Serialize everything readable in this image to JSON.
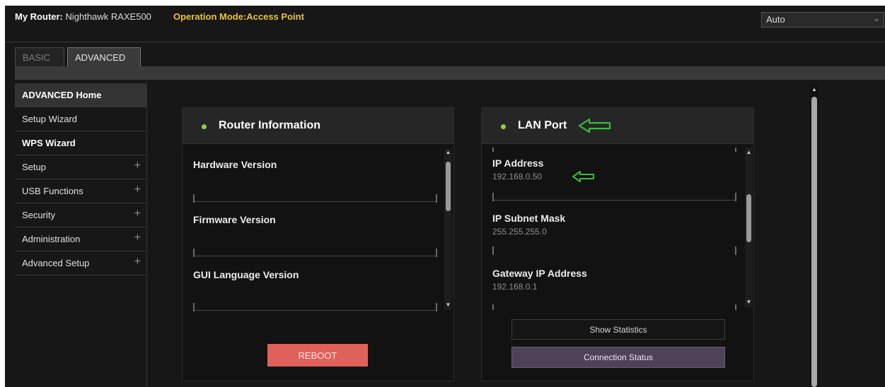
{
  "header": {
    "router_label": "My Router:",
    "router_name": "Nighthawk RAXE500",
    "operation_mode": "Operation Mode:Access Point",
    "language_select": "Auto"
  },
  "tabs": [
    {
      "label": "BASIC",
      "active": false
    },
    {
      "label": "ADVANCED",
      "active": true
    }
  ],
  "sidebar": {
    "items": [
      {
        "label": "ADVANCED Home",
        "expandable": false,
        "active": true
      },
      {
        "label": "Setup Wizard",
        "expandable": false
      },
      {
        "label": "WPS Wizard",
        "expandable": false
      },
      {
        "label": "Setup",
        "expandable": true
      },
      {
        "label": "USB Functions",
        "expandable": true
      },
      {
        "label": "Security",
        "expandable": true
      },
      {
        "label": "Administration",
        "expandable": true
      },
      {
        "label": "Advanced Setup",
        "expandable": true
      }
    ],
    "expand_symbol": "+"
  },
  "router_info": {
    "title": "Router Information",
    "rows": [
      {
        "label": "Hardware Version",
        "value": ""
      },
      {
        "label": "Firmware Version",
        "value": ""
      },
      {
        "label": "GUI Language Version",
        "value": ""
      }
    ],
    "reboot_label": "REBOOT"
  },
  "lan_port": {
    "title": "LAN Port",
    "rows": [
      {
        "label": "IP Address",
        "value": "192.168.0.50"
      },
      {
        "label": "IP Subnet Mask",
        "value": "255.255.255.0"
      },
      {
        "label": "Gateway IP Address",
        "value": "192.168.0.1"
      }
    ],
    "show_statistics_label": "Show Statistics",
    "connection_status_label": "Connection Status"
  },
  "colors": {
    "accent_yellow": "#e8c43a",
    "status_green": "#8ed04a",
    "annotation_green": "#3dbb3d",
    "reboot_red": "#e0605a",
    "connection_purple": "#4e4258"
  }
}
